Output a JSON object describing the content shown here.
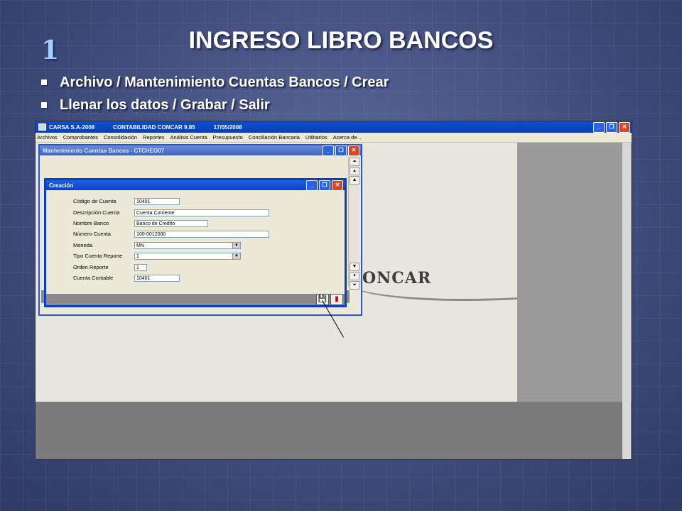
{
  "slide": {
    "number": "1",
    "title": "INGRESO LIBRO BANCOS",
    "bullets": [
      "Archivo / Mantenimiento Cuentas Bancos / Crear",
      "Llenar los datos / Grabar / Salir"
    ]
  },
  "app": {
    "title_company": "CARSA S.A-2008",
    "title_app": "CONTABILIDAD CONCAR 9.85",
    "title_date": "17/05/2008",
    "menu": [
      "Archivos",
      "Comprobantes",
      "Consolidación",
      "Reportes",
      "Análisis Cuenta",
      "Presupuesto",
      "Conciliación Bancaria",
      "Utilitarios",
      "Acerca de..."
    ],
    "logo_text": "ONCAR"
  },
  "mantenimiento": {
    "title": "Mantenimiento Cuentas Bancos - CTCHEO07"
  },
  "creacion": {
    "title": "Creación",
    "fields": {
      "codigo_cuenta": {
        "label": "Código de Cuenta",
        "value": "10401"
      },
      "descripcion_cuenta": {
        "label": "Descripción Cuenta",
        "value": "Cuenta Corriente"
      },
      "nombre_banco": {
        "label": "Nombre Banco",
        "value": "Banco de Credito"
      },
      "numero_cuenta": {
        "label": "Número Cuenta",
        "value": "100-0012000"
      },
      "moneda": {
        "label": "Moneda",
        "value": "MN"
      },
      "tipo_cuenta_reporte": {
        "label": "Tipo Cuenta Reporte",
        "value": "1"
      },
      "orden_reporte": {
        "label": "Orden Reporte",
        "value": "1"
      },
      "cuenta_contable": {
        "label": "Cuenta Contable",
        "value": "10401"
      }
    }
  }
}
